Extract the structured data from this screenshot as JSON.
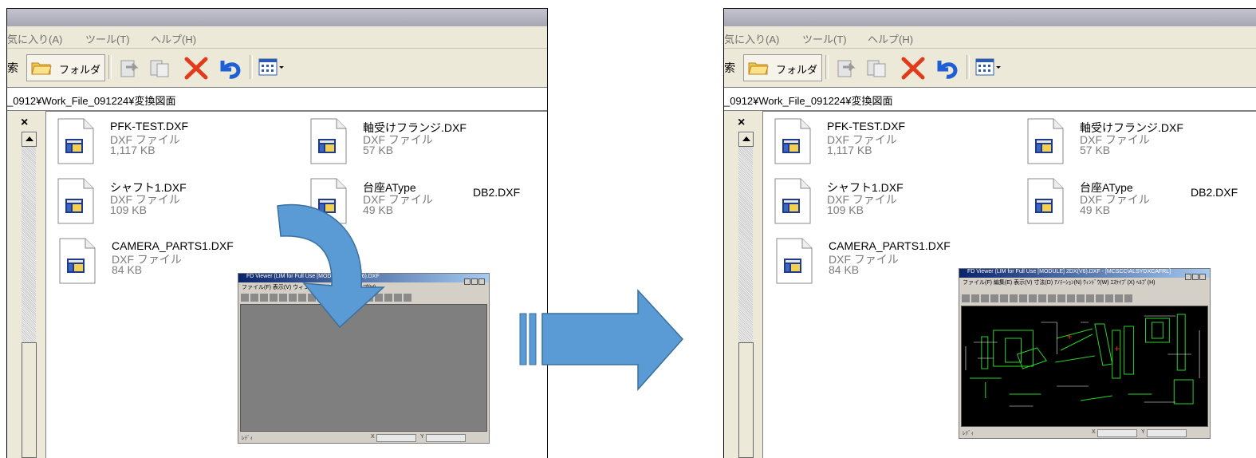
{
  "menu": {
    "favorites": "気に入り(A)",
    "tools": "ツール(T)",
    "help": "ヘルプ(H)"
  },
  "toolbar": {
    "search_label": "索",
    "folders_label": "フォルダ"
  },
  "address": {
    "path": "_0912¥Work_File_091224¥変換図面"
  },
  "sidebar": {
    "close_glyph": "×"
  },
  "files": [
    {
      "name": "PFK-TEST.DXF",
      "type": "DXF ファイル",
      "size": "1,117 KB"
    },
    {
      "name": "軸受けフランジ.DXF",
      "type": "DXF ファイル",
      "size": "57 KB"
    },
    {
      "name": "シャフト1.DXF",
      "type": "DXF ファイル",
      "size": "109 KB"
    },
    {
      "name": "台座AType",
      "type": "DXF ファイル",
      "size": "49 KB"
    },
    {
      "name": "CAMERA_PARTS1.DXF",
      "type": "DXF ファイル",
      "size": "84 KB"
    }
  ],
  "extra_filename": "DB2.DXF",
  "viewer_left": {
    "title": "FD Viewer (LIM for Full Use [MODULE] 2DX(V6).DXF",
    "menu": "ファイル(F)  表示(V)  ウィンドウ(W)  設定(S)  ヘルプ(H)",
    "status": "ﾚﾃﾞｨ",
    "x_label": "X",
    "y_label": "Y"
  },
  "viewer_right": {
    "title": "FD Viewer (LIM for Full Use [MODULE] 2DX(V6).DXF - [MCSCC\\ALSYDXCAFRL]",
    "menu": "ファイル(F)  編集(E)  表示(V)  寸法(D)  ｱﾉﾃｰｼｮﾝ(N)  ｳｨﾝﾄﾞｳ(W)  ｴｽｹｲﾌﾟ(X)  ﾍﾙﾌﾟ(H)",
    "status": "ﾚﾃﾞｨ",
    "x_label": "X",
    "y_label": "Y"
  },
  "colors": {
    "arrow_blue": "#5b9bd5",
    "arrow_outline": "#3a6f9e",
    "cad_background": "#000000",
    "cad_lines": "#2bd22b",
    "cad_annotation": "#ffffff",
    "delete_red": "#e23b1c",
    "undo_blue": "#1f5fd6"
  }
}
